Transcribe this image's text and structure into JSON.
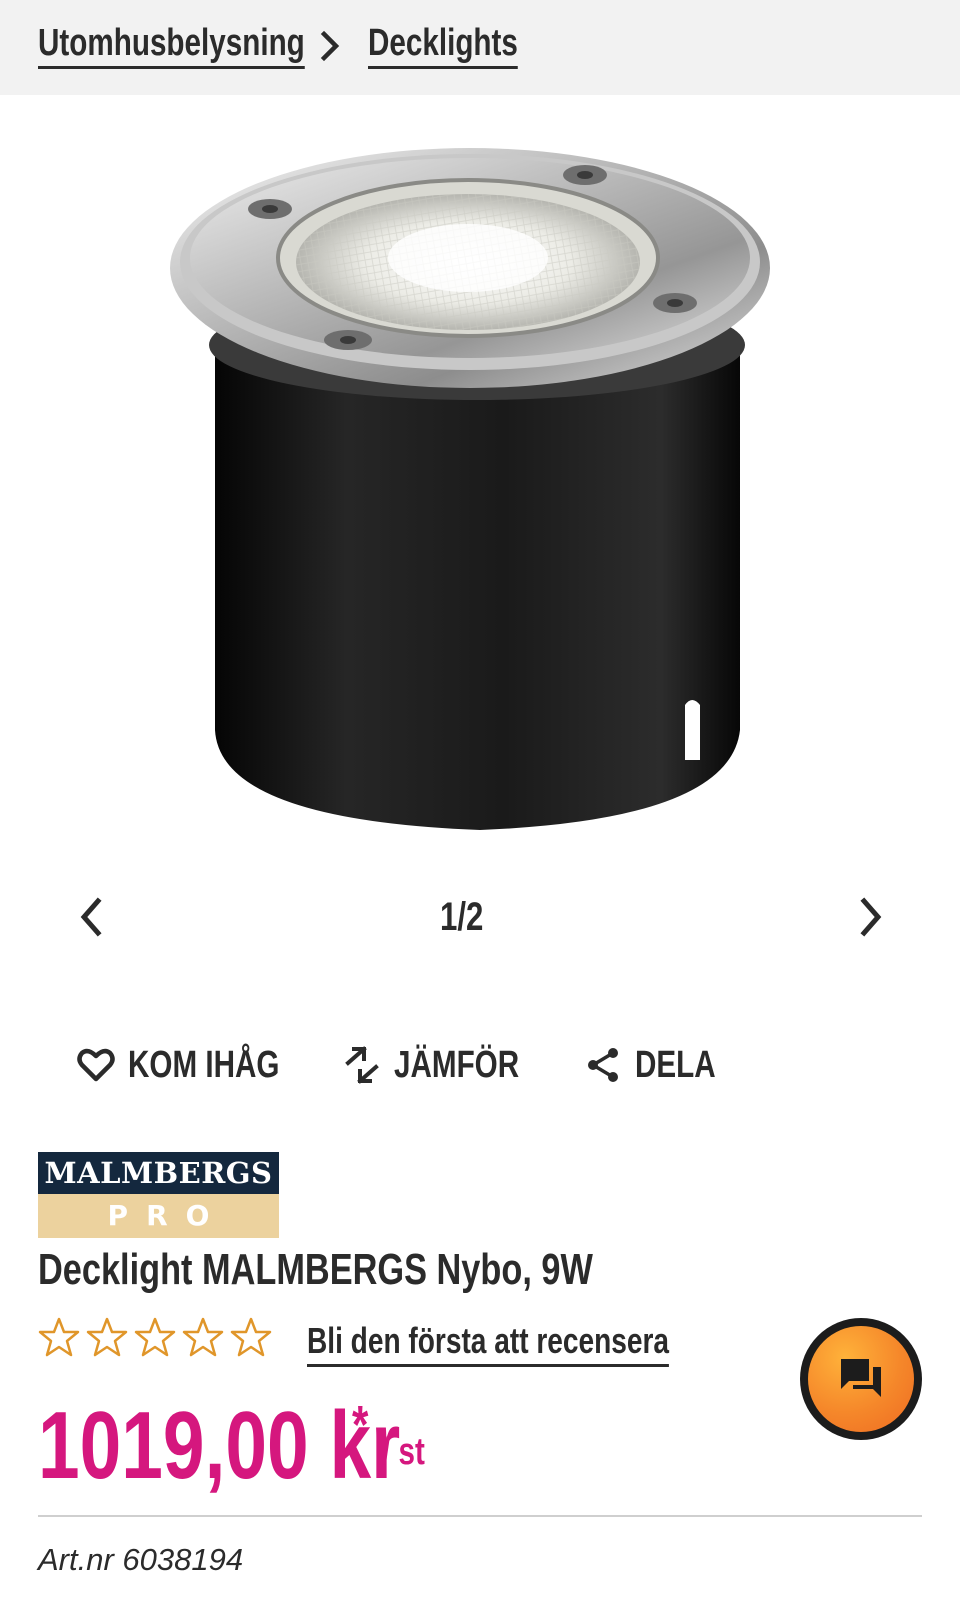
{
  "breadcrumb": {
    "items": [
      {
        "label": "Utomhusbelysning"
      },
      {
        "label": "Decklights"
      }
    ]
  },
  "gallery": {
    "counter": "1/2",
    "image_alt": "Decklight MALMBERGS Nybo, 9W"
  },
  "actions": {
    "favorite": "KOM IHÅG",
    "compare": "JÄMFÖR",
    "share": "DELA"
  },
  "brand": {
    "line1": "MALMBERGS",
    "line2": "PRO"
  },
  "product": {
    "title": "Decklight MALMBERGS Nybo, 9W",
    "rating": {
      "value": 0,
      "max": 5
    },
    "review_link": "Bli den första att recensera",
    "price": "1019,00 kr",
    "price_marker": "*",
    "price_unit": "/ st",
    "article_number": "Art.nr 6038194"
  },
  "colors": {
    "price": "#d5177e",
    "star": "#e0962a",
    "chat": "#f5872a",
    "brand_dark": "#14283e",
    "brand_gold": "#ecd29e"
  },
  "icons": [
    "chevron-right-icon",
    "chevron-left-icon",
    "heart-icon",
    "compare-icon",
    "share-icon",
    "star-outline-icon",
    "chat-icon"
  ]
}
